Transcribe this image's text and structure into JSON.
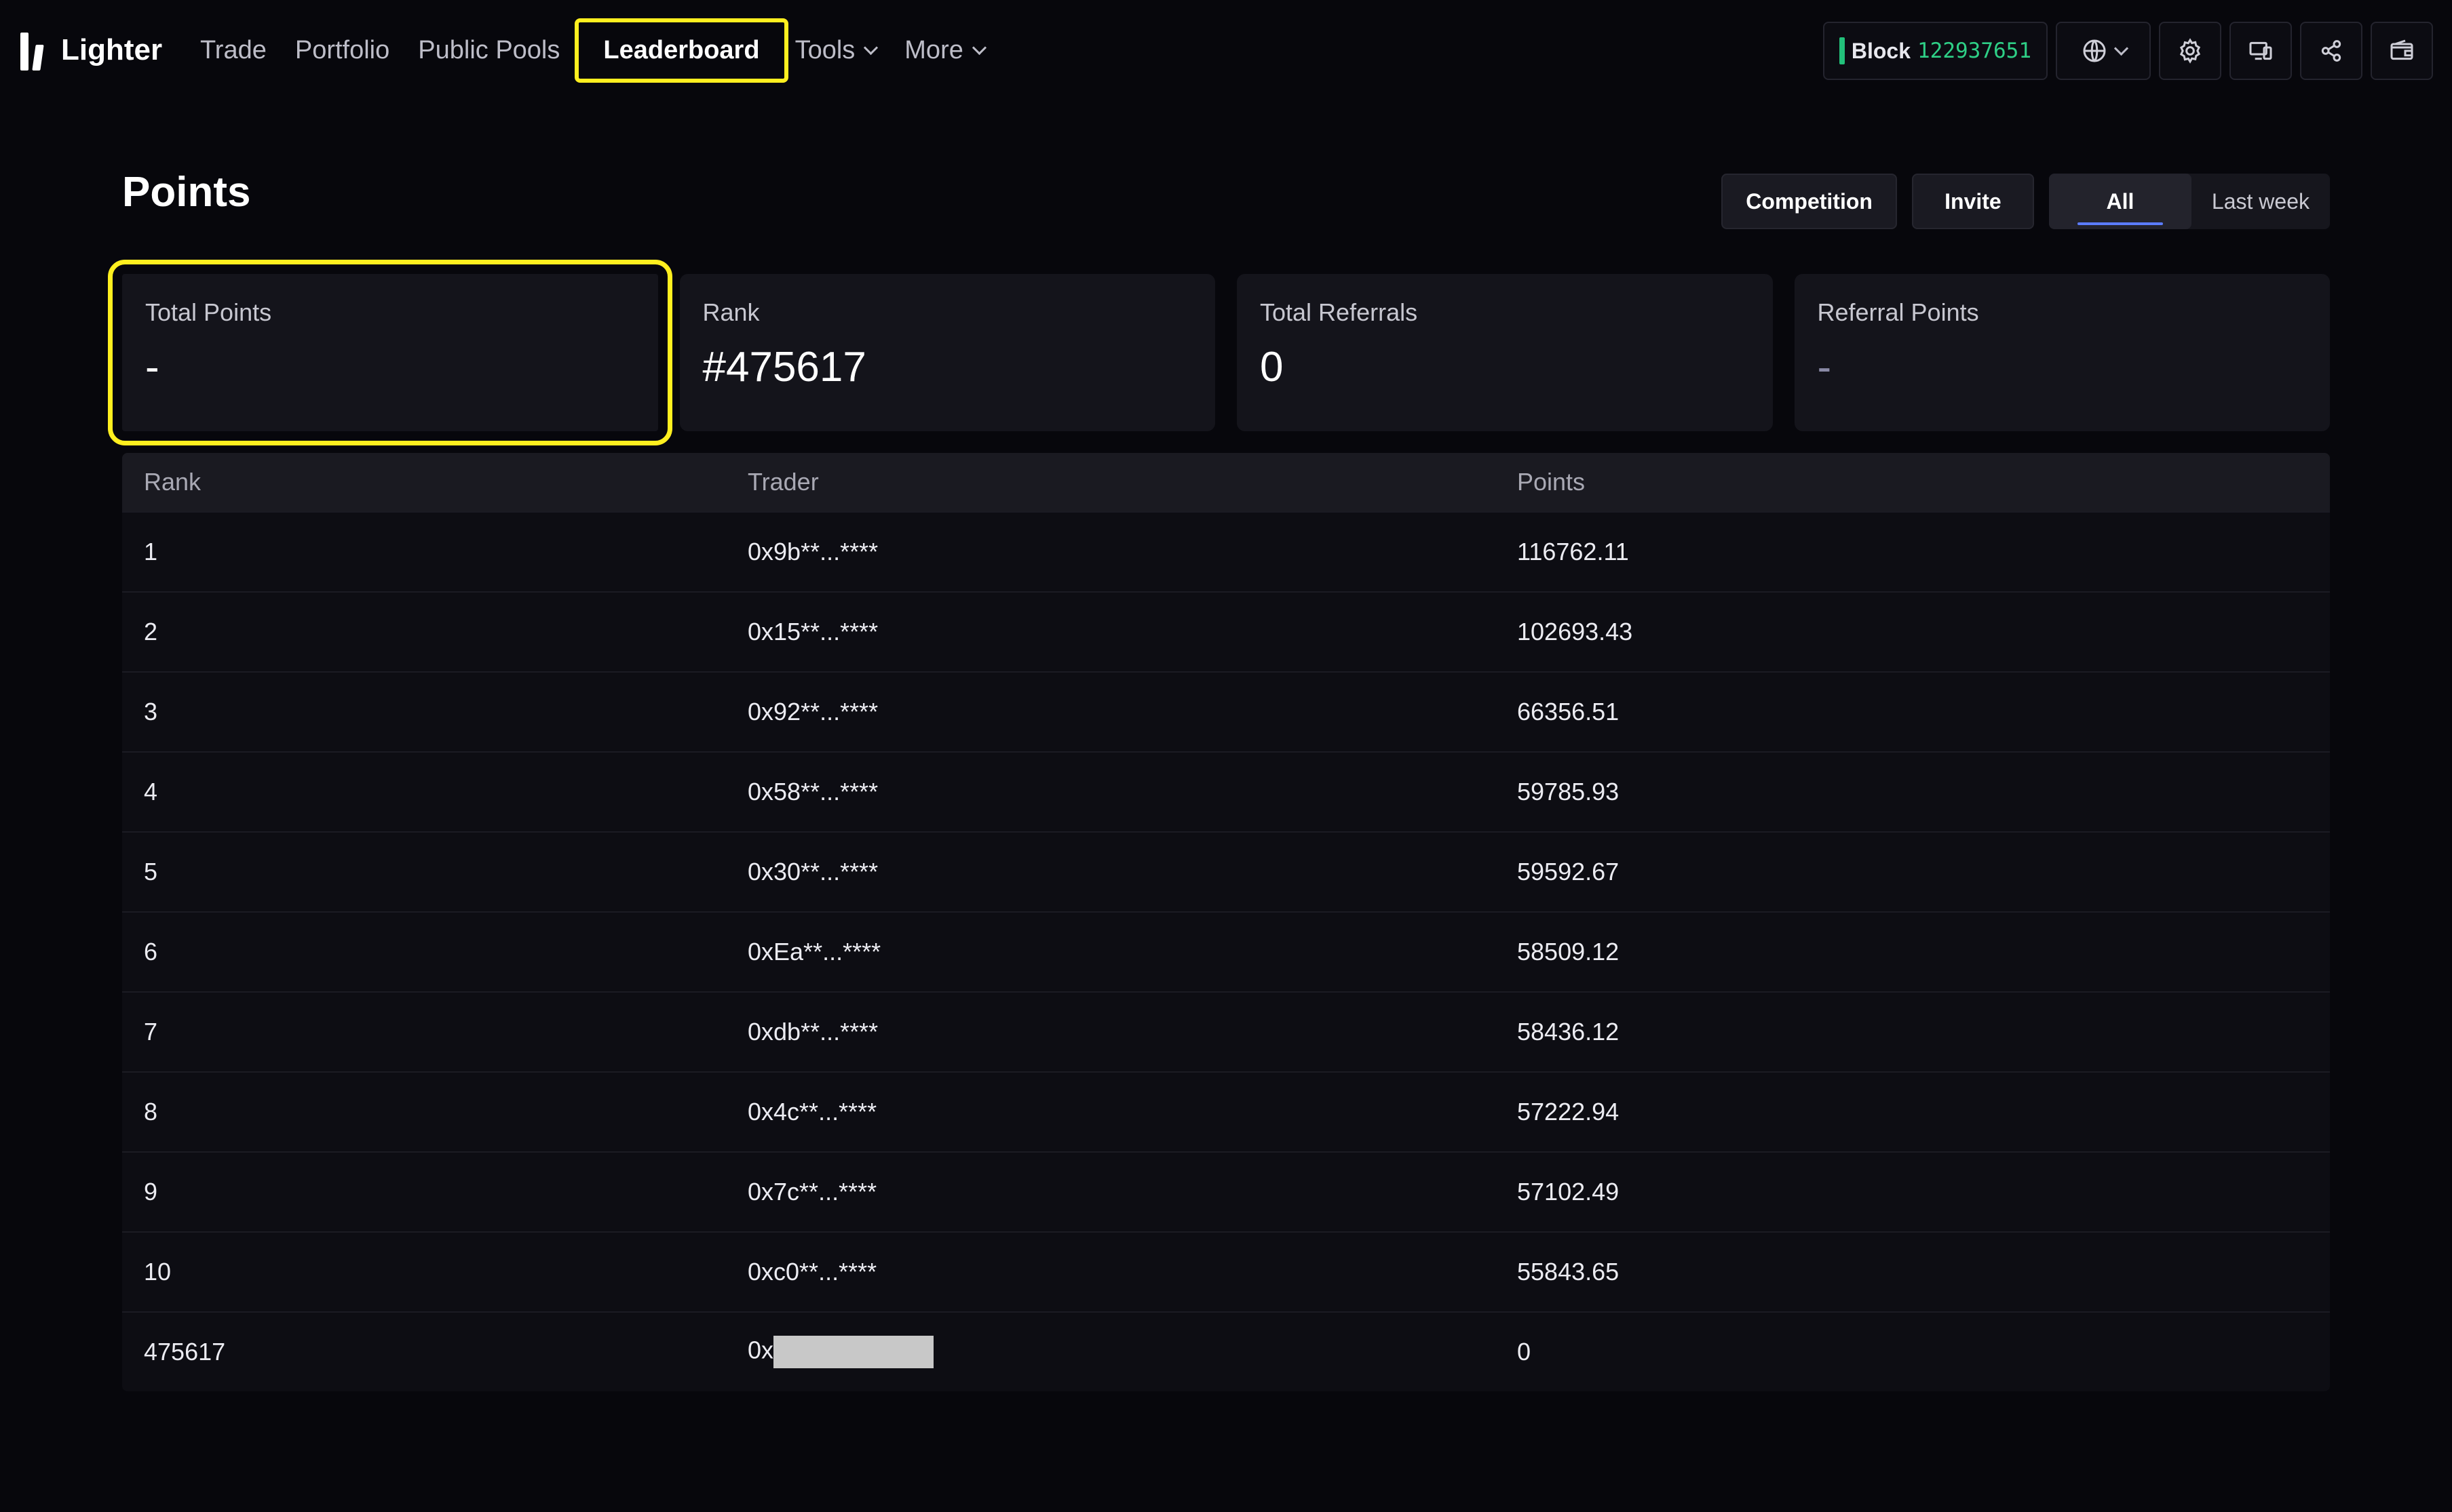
{
  "app": {
    "name": "Lighter"
  },
  "nav": {
    "items": [
      "Trade",
      "Portfolio",
      "Public Pools",
      "Leaderboard",
      "Tools",
      "More"
    ],
    "active": "Leaderboard"
  },
  "header": {
    "block_label": "Block",
    "block_number": "122937651"
  },
  "page": {
    "title": "Points",
    "tabs": {
      "competition": "Competition",
      "invite": "Invite",
      "all": "All",
      "last_week": "Last week",
      "selected": "All"
    }
  },
  "stats": [
    {
      "label": "Total Points",
      "value": "-"
    },
    {
      "label": "Rank",
      "value": "#475617"
    },
    {
      "label": "Total Referrals",
      "value": "0"
    },
    {
      "label": "Referral Points",
      "value": "-"
    }
  ],
  "table": {
    "headers": [
      "Rank",
      "Trader",
      "Points"
    ],
    "rows": [
      {
        "rank": "1",
        "trader": "0x9b**...****",
        "points": "116762.11"
      },
      {
        "rank": "2",
        "trader": "0x15**...****",
        "points": "102693.43"
      },
      {
        "rank": "3",
        "trader": "0x92**...****",
        "points": "66356.51"
      },
      {
        "rank": "4",
        "trader": "0x58**...****",
        "points": "59785.93"
      },
      {
        "rank": "5",
        "trader": "0x30**...****",
        "points": "59592.67"
      },
      {
        "rank": "6",
        "trader": "0xEa**...****",
        "points": "58509.12"
      },
      {
        "rank": "7",
        "trader": "0xdb**...****",
        "points": "58436.12"
      },
      {
        "rank": "8",
        "trader": "0x4c**...****",
        "points": "57222.94"
      },
      {
        "rank": "9",
        "trader": "0x7c**...****",
        "points": "57102.49"
      },
      {
        "rank": "10",
        "trader": "0xc0**...****",
        "points": "55843.65"
      }
    ],
    "self_row": {
      "rank": "475617",
      "trader_prefix": "0x",
      "points": "0"
    }
  },
  "colors": {
    "highlight": "#ffef1f",
    "block_number": "#2ecf86",
    "accent": "#5b7cff"
  },
  "icons": [
    "globe-icon",
    "settings-icon",
    "devices-icon",
    "share-icon",
    "wallet-icon"
  ]
}
